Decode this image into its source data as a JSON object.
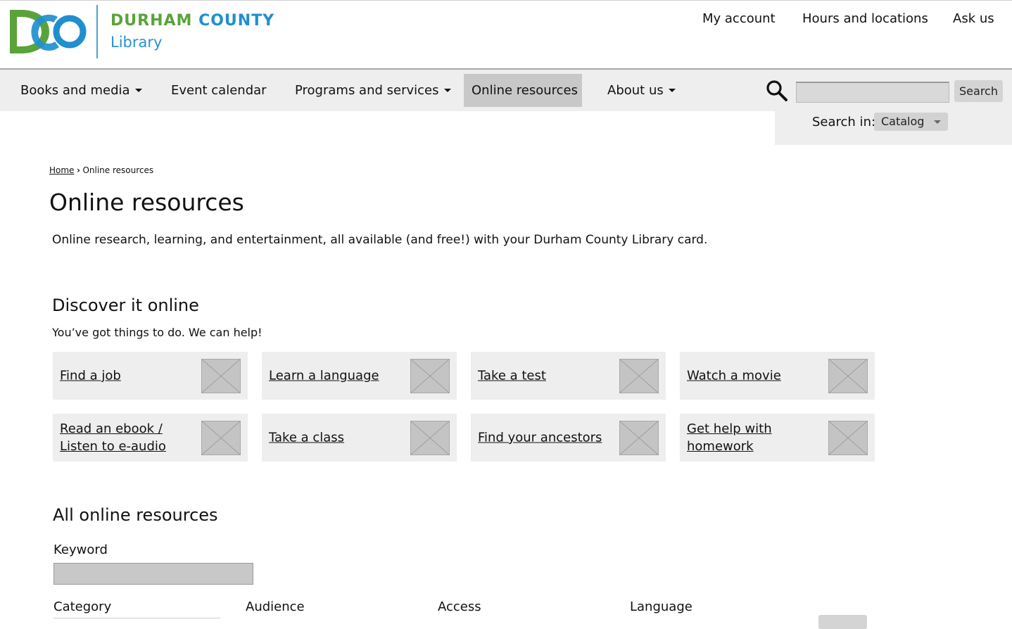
{
  "brand": {
    "name_part1": "DURHAM",
    "name_part2": "COUNTY",
    "subtitle": "Library",
    "logo_text": "DCO",
    "colors": {
      "green": "#5aa33a",
      "blue": "#1f8fcf"
    }
  },
  "utility_nav": [
    "My account",
    "Hours and locations",
    "Ask us"
  ],
  "main_nav": [
    {
      "label": "Books and media",
      "has_dropdown": true
    },
    {
      "label": "Event calendar",
      "has_dropdown": false
    },
    {
      "label": "Programs and services",
      "has_dropdown": true
    },
    {
      "label": "Online resources",
      "has_dropdown": false,
      "active": true
    },
    {
      "label": "About us",
      "has_dropdown": true
    }
  ],
  "search": {
    "icon": "search-icon",
    "button_label": "Search",
    "search_in_label": "Search in:",
    "search_in_value": "Catalog",
    "input_value": ""
  },
  "breadcrumb": {
    "home": "Home",
    "current": "Online resources"
  },
  "page": {
    "title": "Online resources",
    "intro": "Online research, learning, and entertainment, all available (and free!) with your Durham County Library card."
  },
  "discover": {
    "title": "Discover it online",
    "subtitle": "You’ve got things to do. We can help!",
    "tiles": [
      {
        "label": "Find a job"
      },
      {
        "label": "Learn a language"
      },
      {
        "label": "Take a test"
      },
      {
        "label": "Watch a movie"
      },
      {
        "label": "Read an ebook /\nListen to e-audio"
      },
      {
        "label": "Take a class"
      },
      {
        "label": "Find your ancestors"
      },
      {
        "label": "Get help with\nhomework"
      }
    ]
  },
  "all_resources": {
    "title": "All online resources",
    "keyword_label": "Keyword",
    "keyword_value": "",
    "filters": [
      "Category",
      "Audience",
      "Access",
      "Language"
    ]
  },
  "colors": {
    "nav_bg": "#eeeeee",
    "active_nav": "#c8c8c8",
    "tile_bg": "#eeeeee"
  }
}
